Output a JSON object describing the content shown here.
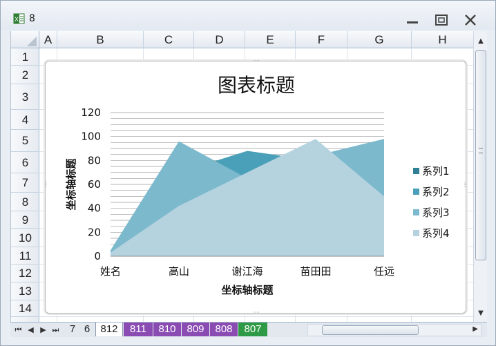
{
  "window": {
    "title": "8",
    "app_icon": "excel-icon"
  },
  "columns": [
    "A",
    "B",
    "C",
    "D",
    "E",
    "F",
    "G",
    "H"
  ],
  "rows": [
    "1",
    "2",
    "3",
    "4",
    "5",
    "6",
    "7",
    "8",
    "9",
    "10",
    "11",
    "12",
    "13",
    "14"
  ],
  "chart_data": {
    "type": "area",
    "title": "图表标题",
    "xlabel": "坐标轴标题",
    "ylabel": "坐标轴标题",
    "categories": [
      "姓名",
      "高山",
      "谢江海",
      "苗田田",
      "任远"
    ],
    "ylim": [
      0,
      120
    ],
    "yticks": [
      "0",
      "20",
      "40",
      "60",
      "80",
      "100",
      "120"
    ],
    "legend_position": "right",
    "gridlines": true,
    "series": [
      {
        "name": "系列1",
        "values": [
          5,
          65,
          75,
          82,
          90
        ],
        "color": "#2f7f97"
      },
      {
        "name": "系列2",
        "values": [
          5,
          70,
          88,
          80,
          95
        ],
        "color": "#4aa0b8"
      },
      {
        "name": "系列3",
        "values": [
          5,
          96,
          65,
          84,
          98
        ],
        "color": "#7db9cd"
      },
      {
        "name": "系列4",
        "values": [
          3,
          42,
          70,
          98,
          50
        ],
        "color": "#b5d3df"
      }
    ]
  },
  "sheet_tabs": [
    {
      "label": "7",
      "style": "plain"
    },
    {
      "label": "6",
      "style": "plain"
    },
    {
      "label": "812",
      "style": "active"
    },
    {
      "label": "811",
      "style": "purple"
    },
    {
      "label": "810",
      "style": "purple"
    },
    {
      "label": "809",
      "style": "purple"
    },
    {
      "label": "808",
      "style": "purple"
    },
    {
      "label": "807",
      "style": "green"
    }
  ]
}
